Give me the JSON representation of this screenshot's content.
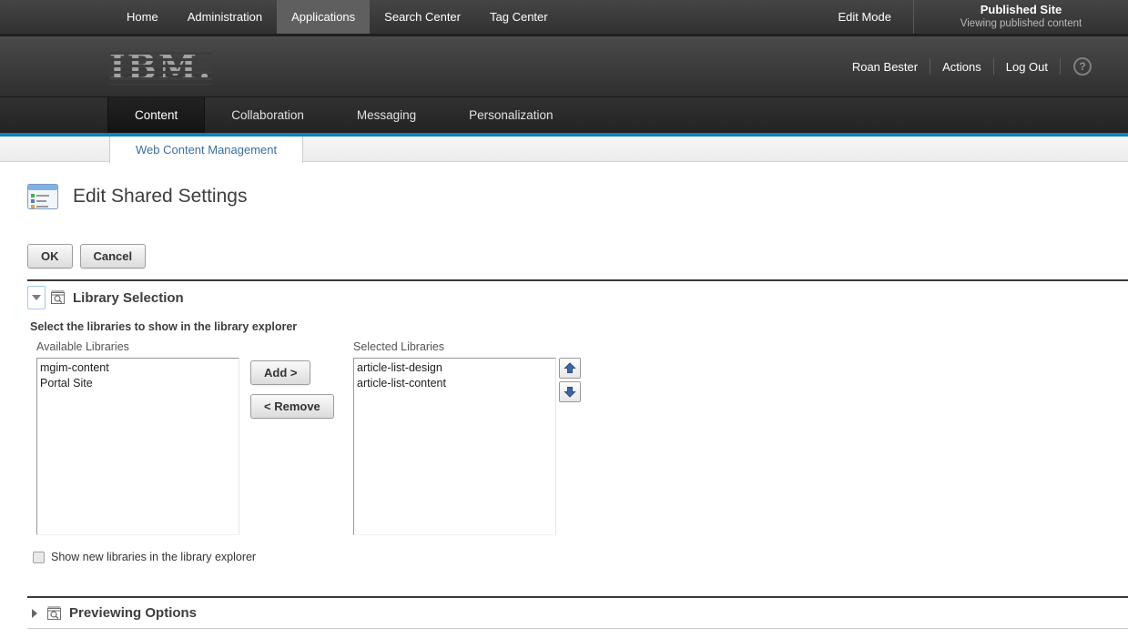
{
  "topbar": {
    "items": [
      {
        "label": "Home"
      },
      {
        "label": "Administration"
      },
      {
        "label": "Applications"
      },
      {
        "label": "Search Center"
      },
      {
        "label": "Tag Center"
      }
    ],
    "active_item": "Applications",
    "edit_mode_label": "Edit Mode",
    "site_title": "Published Site",
    "site_subtitle": "Viewing published content"
  },
  "banner": {
    "logo_text": "IBM.",
    "user_name": "Roan Bester",
    "actions_label": "Actions",
    "logout_label": "Log Out",
    "help_glyph": "?"
  },
  "tabs": {
    "items": [
      {
        "label": "Content"
      },
      {
        "label": "Collaboration"
      },
      {
        "label": "Messaging"
      },
      {
        "label": "Personalization"
      }
    ],
    "active_item": "Content"
  },
  "subtab": {
    "label": "Web Content Management"
  },
  "page": {
    "title": "Edit Shared Settings"
  },
  "toolbar": {
    "ok_label": "OK",
    "cancel_label": "Cancel"
  },
  "library_selection": {
    "title": "Library Selection",
    "expanded": true,
    "instruction": "Select the libraries to show in the library explorer",
    "available_label": "Available Libraries",
    "selected_label": "Selected Libraries",
    "available_items": [
      "mgim-content",
      "Portal Site"
    ],
    "selected_items": [
      "article-list-design",
      "article-list-content"
    ],
    "add_label": "Add >",
    "remove_label": "< Remove",
    "checkbox_label": "Show new libraries in the library explorer",
    "checkbox_checked": false
  },
  "previewing_options": {
    "title": "Previewing Options",
    "expanded": false
  },
  "colors": {
    "accent_blue": "#0d83b7",
    "subtab_link_blue": "#3a6f9f",
    "arrow_blue": "#3a67a3",
    "topbar_dark": "#313131",
    "section_border_dark": "#3a3a3a"
  }
}
